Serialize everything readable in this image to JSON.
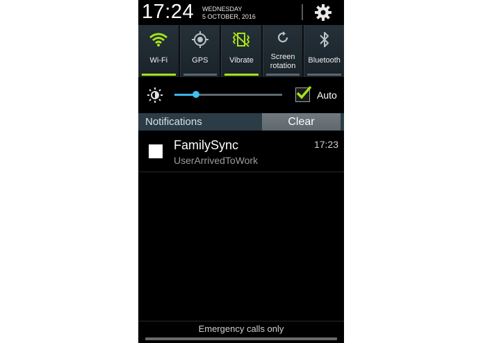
{
  "status": {
    "time": "17:24",
    "weekday": "WEDNESDAY",
    "date": "5 OCTOBER, 2016",
    "settings_icon": "gear-icon"
  },
  "toggles": [
    {
      "label": "Wi-Fi",
      "icon": "wifi-icon",
      "on": true
    },
    {
      "label": "GPS",
      "icon": "gps-icon",
      "on": false
    },
    {
      "label": "Vibrate",
      "icon": "vibrate-icon",
      "on": true
    },
    {
      "label": "Screen rotation",
      "label_line1": "Screen",
      "label_line2": "rotation",
      "icon": "rotation-icon",
      "on": false
    },
    {
      "label": "Bluetooth",
      "icon": "bluetooth-icon",
      "on": false
    }
  ],
  "brightness": {
    "level": 0.2,
    "auto_label": "Auto",
    "auto_checked": true
  },
  "notifications": {
    "title": "Notifications",
    "clear_label": "Clear",
    "items": [
      {
        "app": "FamilySync",
        "text": "UserArrivedToWork",
        "time": "17:23"
      }
    ]
  },
  "footer": {
    "emergency_text": "Emergency calls only"
  },
  "colors": {
    "accent_on": "#a6e318",
    "slider_blue": "#38b6e8",
    "check_green": "#a6e318"
  }
}
